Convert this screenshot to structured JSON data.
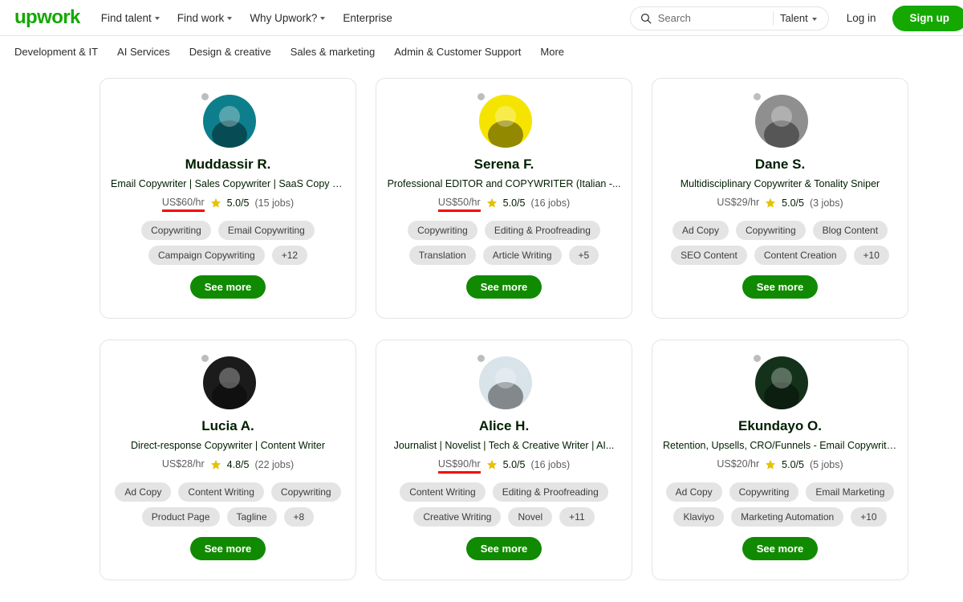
{
  "header": {
    "logo": "upwork",
    "nav": [
      {
        "label": "Find talent",
        "caret": true
      },
      {
        "label": "Find work",
        "caret": true
      },
      {
        "label": "Why Upwork?",
        "caret": true
      },
      {
        "label": "Enterprise",
        "caret": false
      }
    ],
    "search": {
      "placeholder": "Search",
      "value": "",
      "scope": "Talent",
      "icon": "search-icon"
    },
    "login_label": "Log in",
    "signup_label": "Sign up"
  },
  "categories": [
    "Development & IT",
    "AI Services",
    "Design & creative",
    "Sales & marketing",
    "Admin & Customer Support",
    "More"
  ],
  "colors": {
    "brand_green": "#14a800",
    "button_green": "#108a00",
    "underline_red": "#fc0000",
    "star_gold": "#e5c207",
    "tag_gray": "#e4e4e4",
    "border_gray": "#e4e4e4"
  },
  "see_more_label": "See more",
  "freelancers": [
    {
      "name": "Muddassir R.",
      "tagline": "Email Copywriter | Sales Copywriter | SaaS Copy Chief",
      "rate": "US$60/hr",
      "rate_underlined": true,
      "rating": "5.0/5",
      "jobs": "(15 jobs)",
      "tags": [
        "Copywriting",
        "Email Copywriting",
        "Campaign Copywriting",
        "+12"
      ],
      "avatar_bg": "#0d7f8c",
      "status": "offline"
    },
    {
      "name": "Serena F.",
      "tagline": "Professional EDITOR and COPYWRITER (Italian -...",
      "rate": "US$50/hr",
      "rate_underlined": true,
      "rating": "5.0/5",
      "jobs": "(16 jobs)",
      "tags": [
        "Copywriting",
        "Editing & Proofreading",
        "Translation",
        "Article Writing",
        "+5"
      ],
      "avatar_bg": "#f5e400",
      "status": "offline"
    },
    {
      "name": "Dane S.",
      "tagline": "Multidisciplinary Copywriter & Tonality Sniper",
      "rate": "US$29/hr",
      "rate_underlined": false,
      "rating": "5.0/5",
      "jobs": "(3 jobs)",
      "tags": [
        "Ad Copy",
        "Copywriting",
        "Blog Content",
        "SEO Content",
        "Content Creation",
        "+10"
      ],
      "avatar_bg": "#8f8f8f",
      "status": "offline"
    },
    {
      "name": "Lucia A.",
      "tagline": "Direct-response Copywriter | Content Writer",
      "rate": "US$28/hr",
      "rate_underlined": false,
      "rating": "4.8/5",
      "jobs": "(22 jobs)",
      "tags": [
        "Ad Copy",
        "Content Writing",
        "Copywriting",
        "Product Page",
        "Tagline",
        "+8"
      ],
      "avatar_bg": "#1b1b1b",
      "status": "offline"
    },
    {
      "name": "Alice H.",
      "tagline": "Journalist | Novelist | Tech & Creative Writer | AI...",
      "rate": "US$90/hr",
      "rate_underlined": true,
      "rating": "5.0/5",
      "jobs": "(16 jobs)",
      "tags": [
        "Content Writing",
        "Editing & Proofreading",
        "Creative Writing",
        "Novel",
        "+11"
      ],
      "avatar_bg": "#d9e3ea",
      "status": "offline"
    },
    {
      "name": "Ekundayo O.",
      "tagline": "Retention, Upsells, CRO/Funnels - Email Copywriter for..",
      "rate": "US$20/hr",
      "rate_underlined": false,
      "rating": "5.0/5",
      "jobs": "(5 jobs)",
      "tags": [
        "Ad Copy",
        "Copywriting",
        "Email Marketing",
        "Klaviyo",
        "Marketing Automation",
        "+10"
      ],
      "avatar_bg": "#14321a",
      "status": "offline"
    }
  ]
}
